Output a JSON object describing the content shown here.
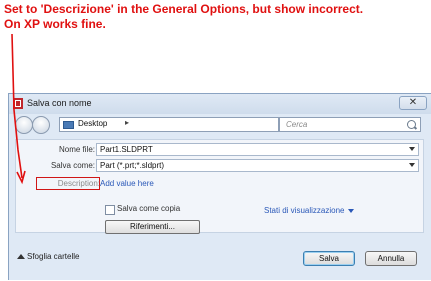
{
  "annotation": {
    "line1": "Set to 'Descrizione' in the General Options, but show incorrect.",
    "line2": "On XP works fine."
  },
  "dialog": {
    "title": "Salva con nome",
    "close_label": "✕",
    "address": {
      "location": "Desktop",
      "chevron": "▸"
    },
    "search_placeholder": "Cerca",
    "filename": {
      "label": "Nome file:",
      "value": "Part1.SLDPRT"
    },
    "save_as_type": {
      "label": "Salva come:",
      "value": "Part (*.prt;*.sldprt)"
    },
    "description": {
      "label": "Description:",
      "value": "Add value here"
    },
    "save_copy_label": "Salva come copia",
    "display_states_label": "Stati di visualizzazione",
    "references_label": "Riferimenti...",
    "browse_folders_label": "Sfoglia cartelle",
    "save_label": "Salva",
    "cancel_label": "Annulla"
  },
  "colors": {
    "annotation": "#e01010",
    "link": "#2a58b8",
    "dialog_bg": "#dfe9f5"
  }
}
